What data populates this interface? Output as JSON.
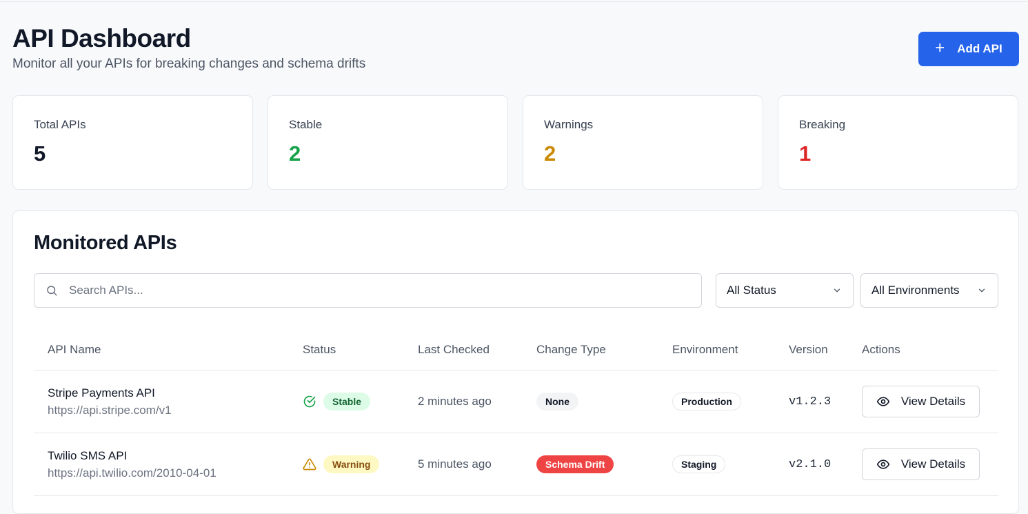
{
  "header": {
    "title": "API Dashboard",
    "subtitle": "Monitor all your APIs for breaking changes and schema drifts",
    "add_button": "Add API"
  },
  "stats": [
    {
      "label": "Total APIs",
      "value": "5",
      "color": "#111827"
    },
    {
      "label": "Stable",
      "value": "2",
      "color": "#16a34a"
    },
    {
      "label": "Warnings",
      "value": "2",
      "color": "#ca8a04"
    },
    {
      "label": "Breaking",
      "value": "1",
      "color": "#dc2626"
    }
  ],
  "panel": {
    "title": "Monitored APIs",
    "search_placeholder": "Search APIs...",
    "status_filter": "All Status",
    "env_filter": "All Environments"
  },
  "table": {
    "columns": [
      "API Name",
      "Status",
      "Last Checked",
      "Change Type",
      "Environment",
      "Version",
      "Actions"
    ],
    "rows": [
      {
        "name": "Stripe Payments API",
        "url": "https://api.stripe.com/v1",
        "status": "Stable",
        "status_icon": "check-circle-icon",
        "last_checked": "2 minutes ago",
        "change_type": "None",
        "environment": "Production",
        "version": "v1.2.3",
        "action": "View Details"
      },
      {
        "name": "Twilio SMS API",
        "url": "https://api.twilio.com/2010-04-01",
        "status": "Warning",
        "status_icon": "warning-triangle-icon",
        "last_checked": "5 minutes ago",
        "change_type": "Schema Drift",
        "environment": "Staging",
        "version": "v2.1.0",
        "action": "View Details"
      }
    ]
  },
  "colors": {
    "accent": "#2563eb",
    "stable": "#16a34a",
    "warning": "#ca8a04",
    "breaking": "#dc2626"
  }
}
